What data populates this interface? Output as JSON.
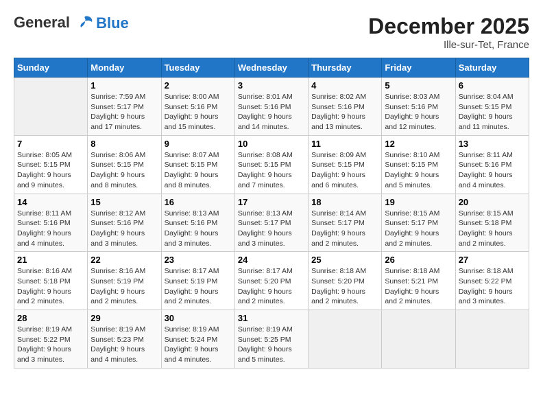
{
  "header": {
    "logo_line1": "General",
    "logo_line2": "Blue",
    "month_year": "December 2025",
    "location": "Ille-sur-Tet, France"
  },
  "days_of_week": [
    "Sunday",
    "Monday",
    "Tuesday",
    "Wednesday",
    "Thursday",
    "Friday",
    "Saturday"
  ],
  "weeks": [
    [
      {
        "day": "",
        "empty": true
      },
      {
        "day": "1",
        "sunrise": "Sunrise: 7:59 AM",
        "sunset": "Sunset: 5:17 PM",
        "daylight": "Daylight: 9 hours and 17 minutes."
      },
      {
        "day": "2",
        "sunrise": "Sunrise: 8:00 AM",
        "sunset": "Sunset: 5:16 PM",
        "daylight": "Daylight: 9 hours and 15 minutes."
      },
      {
        "day": "3",
        "sunrise": "Sunrise: 8:01 AM",
        "sunset": "Sunset: 5:16 PM",
        "daylight": "Daylight: 9 hours and 14 minutes."
      },
      {
        "day": "4",
        "sunrise": "Sunrise: 8:02 AM",
        "sunset": "Sunset: 5:16 PM",
        "daylight": "Daylight: 9 hours and 13 minutes."
      },
      {
        "day": "5",
        "sunrise": "Sunrise: 8:03 AM",
        "sunset": "Sunset: 5:16 PM",
        "daylight": "Daylight: 9 hours and 12 minutes."
      },
      {
        "day": "6",
        "sunrise": "Sunrise: 8:04 AM",
        "sunset": "Sunset: 5:15 PM",
        "daylight": "Daylight: 9 hours and 11 minutes."
      }
    ],
    [
      {
        "day": "7",
        "sunrise": "Sunrise: 8:05 AM",
        "sunset": "Sunset: 5:15 PM",
        "daylight": "Daylight: 9 hours and 9 minutes."
      },
      {
        "day": "8",
        "sunrise": "Sunrise: 8:06 AM",
        "sunset": "Sunset: 5:15 PM",
        "daylight": "Daylight: 9 hours and 8 minutes."
      },
      {
        "day": "9",
        "sunrise": "Sunrise: 8:07 AM",
        "sunset": "Sunset: 5:15 PM",
        "daylight": "Daylight: 9 hours and 8 minutes."
      },
      {
        "day": "10",
        "sunrise": "Sunrise: 8:08 AM",
        "sunset": "Sunset: 5:15 PM",
        "daylight": "Daylight: 9 hours and 7 minutes."
      },
      {
        "day": "11",
        "sunrise": "Sunrise: 8:09 AM",
        "sunset": "Sunset: 5:15 PM",
        "daylight": "Daylight: 9 hours and 6 minutes."
      },
      {
        "day": "12",
        "sunrise": "Sunrise: 8:10 AM",
        "sunset": "Sunset: 5:15 PM",
        "daylight": "Daylight: 9 hours and 5 minutes."
      },
      {
        "day": "13",
        "sunrise": "Sunrise: 8:11 AM",
        "sunset": "Sunset: 5:16 PM",
        "daylight": "Daylight: 9 hours and 4 minutes."
      }
    ],
    [
      {
        "day": "14",
        "sunrise": "Sunrise: 8:11 AM",
        "sunset": "Sunset: 5:16 PM",
        "daylight": "Daylight: 9 hours and 4 minutes."
      },
      {
        "day": "15",
        "sunrise": "Sunrise: 8:12 AM",
        "sunset": "Sunset: 5:16 PM",
        "daylight": "Daylight: 9 hours and 3 minutes."
      },
      {
        "day": "16",
        "sunrise": "Sunrise: 8:13 AM",
        "sunset": "Sunset: 5:16 PM",
        "daylight": "Daylight: 9 hours and 3 minutes."
      },
      {
        "day": "17",
        "sunrise": "Sunrise: 8:13 AM",
        "sunset": "Sunset: 5:17 PM",
        "daylight": "Daylight: 9 hours and 3 minutes."
      },
      {
        "day": "18",
        "sunrise": "Sunrise: 8:14 AM",
        "sunset": "Sunset: 5:17 PM",
        "daylight": "Daylight: 9 hours and 2 minutes."
      },
      {
        "day": "19",
        "sunrise": "Sunrise: 8:15 AM",
        "sunset": "Sunset: 5:17 PM",
        "daylight": "Daylight: 9 hours and 2 minutes."
      },
      {
        "day": "20",
        "sunrise": "Sunrise: 8:15 AM",
        "sunset": "Sunset: 5:18 PM",
        "daylight": "Daylight: 9 hours and 2 minutes."
      }
    ],
    [
      {
        "day": "21",
        "sunrise": "Sunrise: 8:16 AM",
        "sunset": "Sunset: 5:18 PM",
        "daylight": "Daylight: 9 hours and 2 minutes."
      },
      {
        "day": "22",
        "sunrise": "Sunrise: 8:16 AM",
        "sunset": "Sunset: 5:19 PM",
        "daylight": "Daylight: 9 hours and 2 minutes."
      },
      {
        "day": "23",
        "sunrise": "Sunrise: 8:17 AM",
        "sunset": "Sunset: 5:19 PM",
        "daylight": "Daylight: 9 hours and 2 minutes."
      },
      {
        "day": "24",
        "sunrise": "Sunrise: 8:17 AM",
        "sunset": "Sunset: 5:20 PM",
        "daylight": "Daylight: 9 hours and 2 minutes."
      },
      {
        "day": "25",
        "sunrise": "Sunrise: 8:18 AM",
        "sunset": "Sunset: 5:20 PM",
        "daylight": "Daylight: 9 hours and 2 minutes."
      },
      {
        "day": "26",
        "sunrise": "Sunrise: 8:18 AM",
        "sunset": "Sunset: 5:21 PM",
        "daylight": "Daylight: 9 hours and 2 minutes."
      },
      {
        "day": "27",
        "sunrise": "Sunrise: 8:18 AM",
        "sunset": "Sunset: 5:22 PM",
        "daylight": "Daylight: 9 hours and 3 minutes."
      }
    ],
    [
      {
        "day": "28",
        "sunrise": "Sunrise: 8:19 AM",
        "sunset": "Sunset: 5:22 PM",
        "daylight": "Daylight: 9 hours and 3 minutes."
      },
      {
        "day": "29",
        "sunrise": "Sunrise: 8:19 AM",
        "sunset": "Sunset: 5:23 PM",
        "daylight": "Daylight: 9 hours and 4 minutes."
      },
      {
        "day": "30",
        "sunrise": "Sunrise: 8:19 AM",
        "sunset": "Sunset: 5:24 PM",
        "daylight": "Daylight: 9 hours and 4 minutes."
      },
      {
        "day": "31",
        "sunrise": "Sunrise: 8:19 AM",
        "sunset": "Sunset: 5:25 PM",
        "daylight": "Daylight: 9 hours and 5 minutes."
      },
      {
        "day": "",
        "empty": true
      },
      {
        "day": "",
        "empty": true
      },
      {
        "day": "",
        "empty": true
      }
    ]
  ]
}
